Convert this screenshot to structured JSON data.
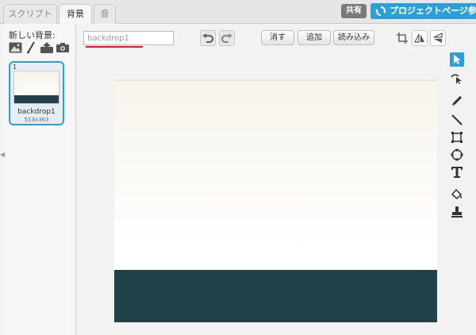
{
  "tabs": [
    {
      "label": "スクリプト",
      "active": false
    },
    {
      "label": "背景",
      "active": true
    },
    {
      "label": "音",
      "active": false
    }
  ],
  "header": {
    "share_label": "共有",
    "project_page_label": "プロジェクトページ参"
  },
  "sidebar": {
    "new_backdrop_label": "新しい背景:",
    "new_icons": [
      "image-library-icon",
      "paint-brush-icon",
      "upload-icon",
      "camera-icon"
    ],
    "backdrops": [
      {
        "number": "1",
        "name": "backdrop1",
        "size": "513x363"
      }
    ]
  },
  "editor": {
    "name_value": "backdrop1",
    "undo_icon": "undo-icon",
    "redo_icon": "redo-icon",
    "clear_label": "消す",
    "add_label": "追加",
    "import_label": "読み込み",
    "crop_icon": "crop-icon",
    "flip_h_icon": "flip-horizontal-icon",
    "flip_v_icon": "flip-vertical-icon"
  },
  "tools": [
    "select-icon",
    "reshape-icon",
    "pencil-icon",
    "line-icon",
    "rectangle-icon",
    "ellipse-icon",
    "text-icon",
    "fill-icon",
    "stamp-icon"
  ],
  "colors": {
    "accent": "#2aa0d8",
    "ground": "#234148",
    "sky_top": "#f7f4eb",
    "underline": "#d62020"
  }
}
